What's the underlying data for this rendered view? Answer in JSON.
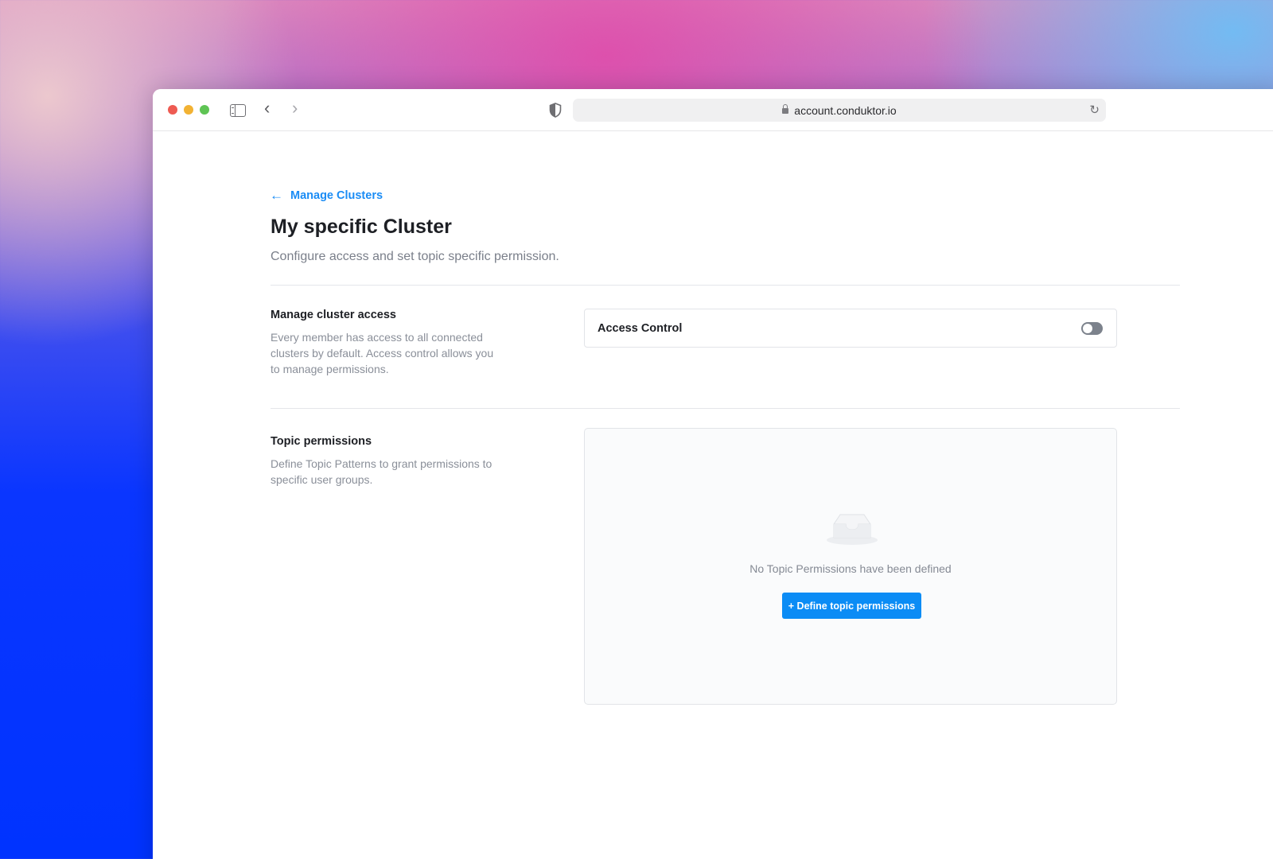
{
  "browser": {
    "url": "account.conduktor.io",
    "back_glyph": "‹",
    "forward_glyph": "›",
    "reload_glyph": "↻"
  },
  "page": {
    "back_link": {
      "arrow": "←",
      "label": "Manage Clusters"
    },
    "title": "My specific Cluster",
    "subtitle": "Configure access and set topic specific permission."
  },
  "cluster_access": {
    "title": "Manage cluster access",
    "description": "Every member has access to all connected clusters by default. Access control allows you to manage permissions.",
    "toggle_label": "Access Control",
    "toggle_on": false
  },
  "topic_permissions": {
    "title": "Topic permissions",
    "description": "Define Topic Patterns to grant permissions to specific user groups.",
    "empty_icon": "empty-inbox-icon",
    "empty_text": "No Topic Permissions have been defined",
    "button_label": "+ Define topic permissions"
  },
  "colors": {
    "accent": "#0b8cf5",
    "link": "#1a8cf5",
    "toggle_off": "#7c828c"
  }
}
